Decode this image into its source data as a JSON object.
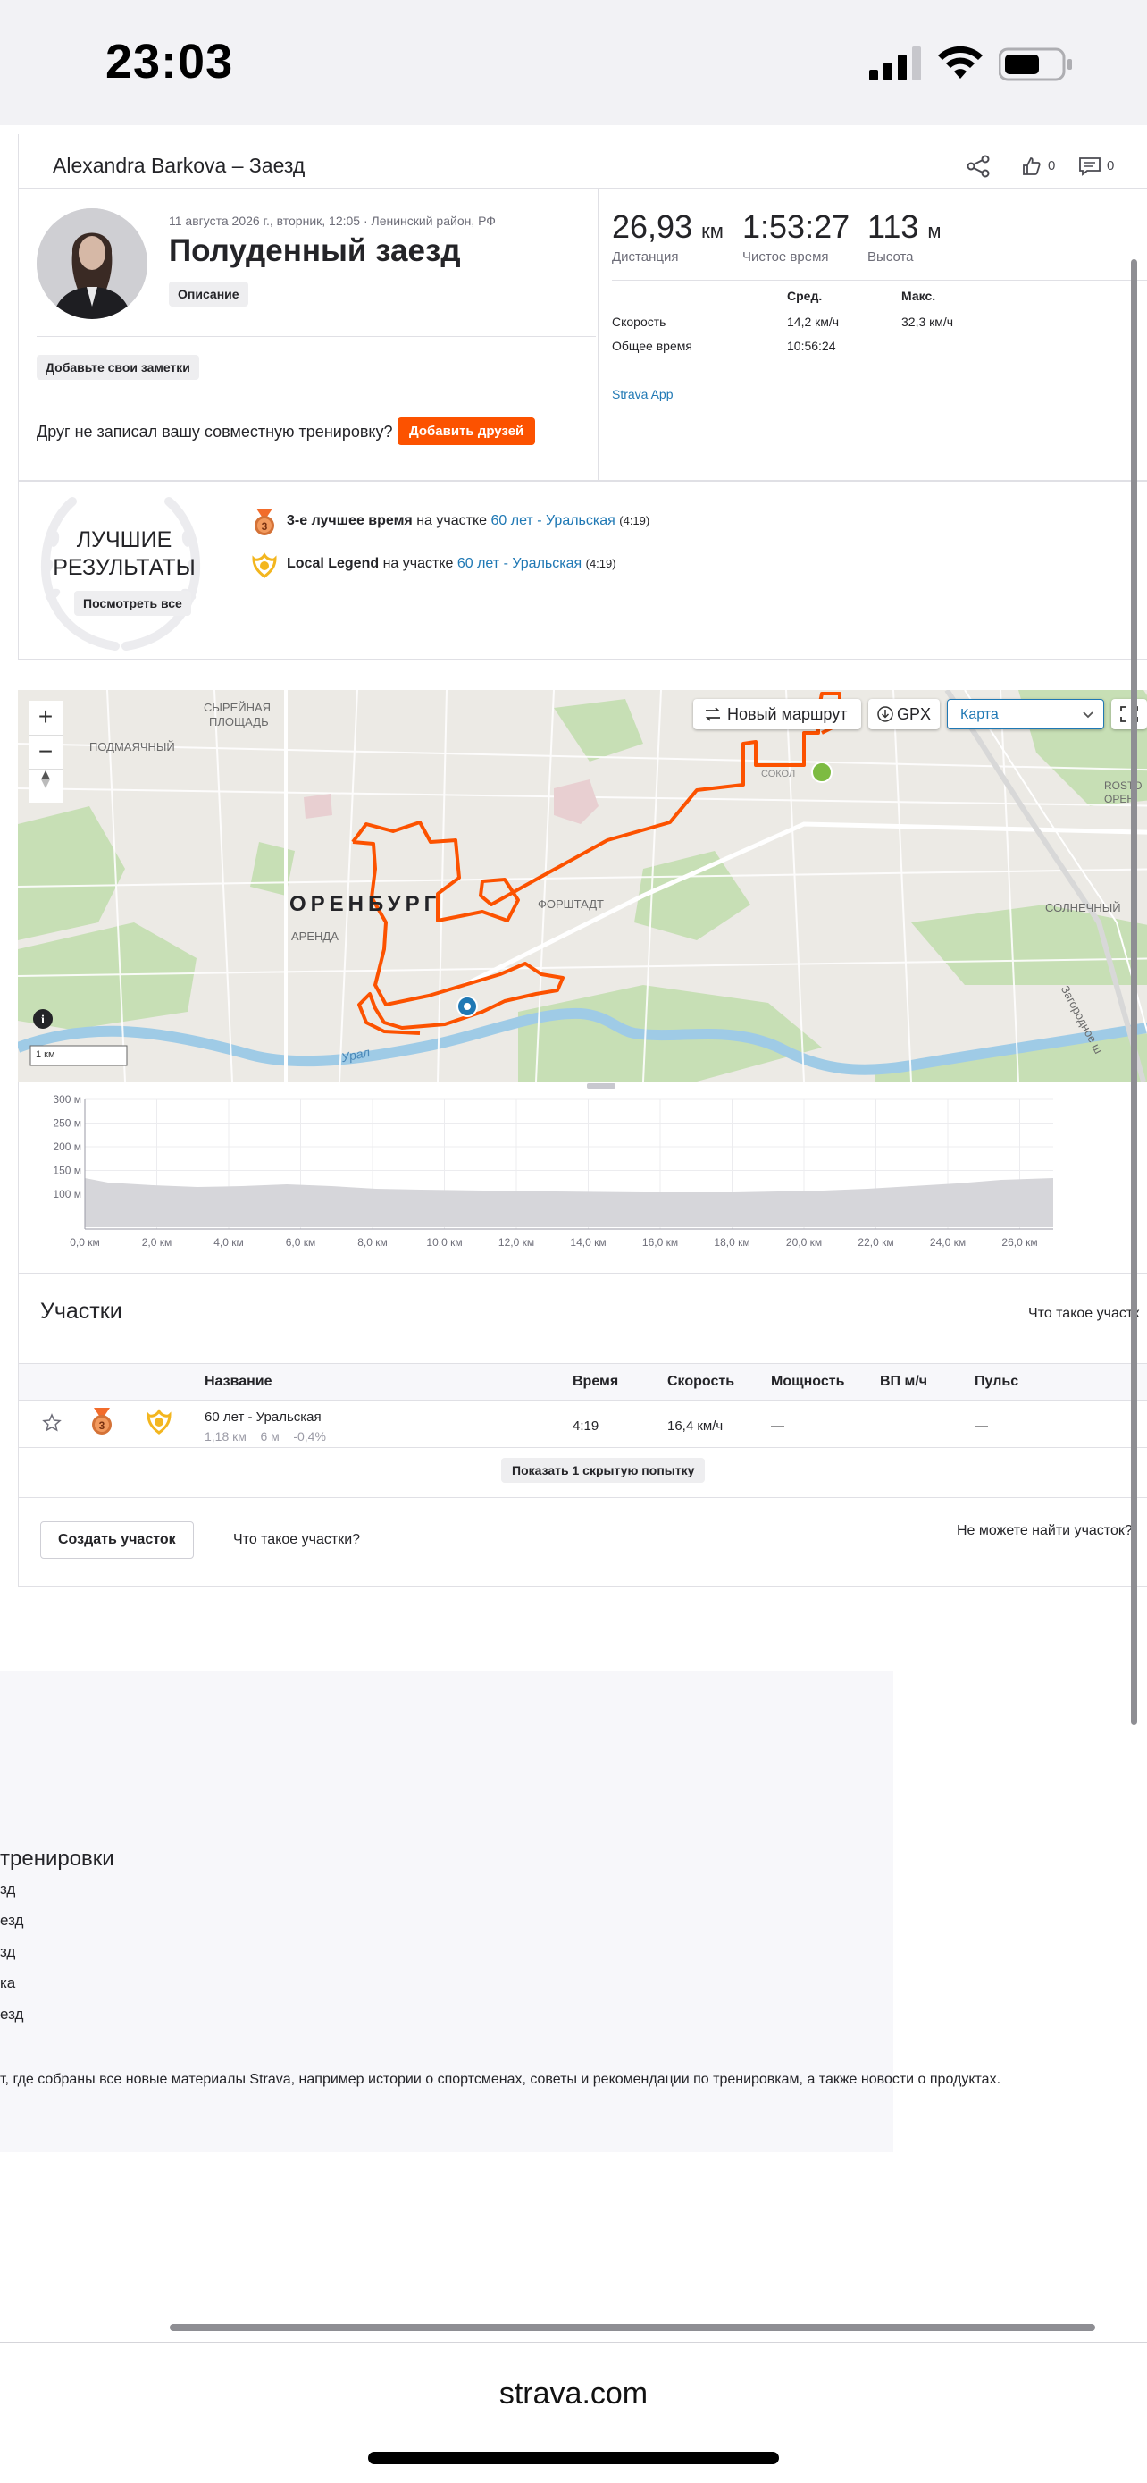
{
  "status_bar": {
    "time": "23:03"
  },
  "header": {
    "title": "Alexandra Barkova – Заезд",
    "kudos_count": "0",
    "comments_count": "0"
  },
  "summary": {
    "meta": "11 августа 2026 г., вторник, 12:05 · Ленинский район, РФ",
    "title": "Полуденный заезд",
    "description_label": "Описание",
    "notes_label": "Добавьте свои заметки",
    "friend_prompt": "Друг не записал вашу совместную тренировку?",
    "add_friends_label": "Добавить друзей",
    "distance": "26,93",
    "distance_unit": "км",
    "distance_label": "Дистанция",
    "moving_time": "1:53:27",
    "moving_time_label": "Чистое время",
    "elevation": "113",
    "elevation_unit": "м",
    "elevation_label": "Высота",
    "col_avg": "Сред.",
    "col_max": "Макс.",
    "speed_label": "Скорость",
    "speed_avg": "14,2 км/ч",
    "speed_max": "32,3 км/ч",
    "elapsed_label": "Общее время",
    "elapsed_value": "10:56:24",
    "device": "Strava App"
  },
  "best_results": {
    "title_line1": "ЛУЧШИЕ",
    "title_line2": "РЕЗУЛЬТАТЫ",
    "see_all": "Посмотреть все",
    "items": [
      {
        "bold": "3-е лучшее время",
        "mid": " на участке ",
        "link": "60 лет - Уральская",
        "time": "(4:19)"
      },
      {
        "bold": "Local Legend",
        "mid": " на участке ",
        "link": "60 лет - Уральская",
        "time": "(4:19)"
      }
    ]
  },
  "map": {
    "new_route": "Новый маршрут",
    "gpx": "GPX",
    "map_type": "Карта",
    "city": "ОРЕНБУРГ",
    "scale": "1 км",
    "labels": {
      "syrnaya": "СЫРЕЙНАЯ",
      "ploshad": "ПЛОЩАДЬ",
      "podmayachny": "ПОДМАЯЧНЫЙ",
      "arenda": "АРЕНДА",
      "forshtadt": "ФОРШТАДТ",
      "solnechny": "СОЛНЕЧНЫЙ",
      "zagorodnoe": "Загородное ш",
      "ural": "Урал",
      "rosto": "ROSTO",
      "oren": "ОРЕН",
      "sokol": "СОКОЛ"
    }
  },
  "elevation_chart": {
    "y_ticks": [
      "300 м",
      "250 м",
      "200 м",
      "150 м",
      "100 м"
    ],
    "x_ticks": [
      "0,0 км",
      "2,0 км",
      "4,0 км",
      "6,0 км",
      "8,0 км",
      "10,0 км",
      "12,0 км",
      "14,0 км",
      "16,0 км",
      "18,0 км",
      "20,0 км",
      "22,0 км",
      "24,0 км",
      "26,0 км"
    ]
  },
  "segments": {
    "title": "Участки",
    "what_link": "Что такое участк",
    "columns": [
      "Название",
      "Время",
      "Скорость",
      "Мощность",
      "ВП м/ч",
      "Пульс"
    ],
    "rows": [
      {
        "name": "60 лет - Уральская",
        "distance": "1,18 км",
        "elev": "6 м",
        "grade": "-0,4%",
        "time": "4:19",
        "speed": "16,4 км/ч",
        "power": "—",
        "vam": "",
        "hr": "—"
      }
    ],
    "show_hidden": "Показать 1 скрытую попытку",
    "create": "Создать участок",
    "what": "Что такое участки?",
    "cant_find": "Не можете найти участок?"
  },
  "promo": {
    "heading": "тренировки",
    "items": [
      "зд",
      "езд",
      "зд",
      "ка",
      "езд"
    ],
    "text": "т, где собраны все новые материалы Strava, например истории о спортсменах, советы и рекомендации по тренировкам, а также новости о продуктах."
  },
  "browser": {
    "url": "strava.com"
  }
}
